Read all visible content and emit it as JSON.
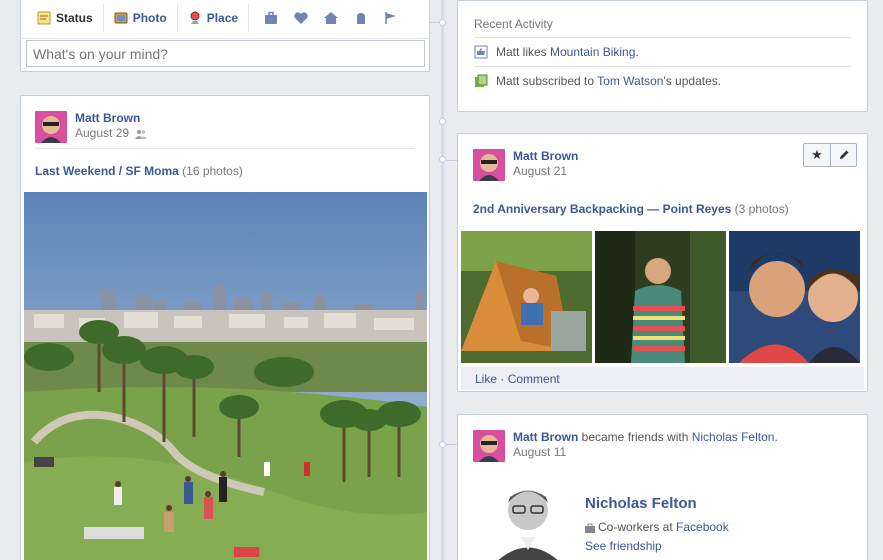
{
  "composer": {
    "tabs": [
      {
        "label": "Status",
        "icon": "status-icon"
      },
      {
        "label": "Photo",
        "icon": "photo-icon"
      },
      {
        "label": "Place",
        "icon": "place-icon"
      }
    ],
    "life_event_icons": [
      "briefcase-icon",
      "heart-icon",
      "home-icon",
      "health-icon",
      "flag-icon"
    ],
    "placeholder": "What's on your mind?"
  },
  "recent_activity": {
    "title": "Recent Activity",
    "rows": [
      {
        "icon": "like-page-icon",
        "pre": "Matt likes ",
        "link": "Mountain Biking",
        "post": "."
      },
      {
        "icon": "subscribe-icon",
        "pre": "Matt subscribed to ",
        "link": "Tom Watson",
        "post": "'s updates."
      }
    ]
  },
  "post_left": {
    "author": "Matt Brown",
    "date": "August 29",
    "album_link": "Last Weekend / SF Moma",
    "album_count": " (16 photos)"
  },
  "post_right_1": {
    "author": "Matt Brown",
    "date": "August 21",
    "album_link": "2nd Anniversary Backpacking — Point Reyes",
    "album_count": " (3 photos)",
    "like": "Like",
    "sep": " · ",
    "comment": "Comment"
  },
  "post_right_2": {
    "author": "Matt Brown",
    "action": " became friends with ",
    "friend_link": "Nicholas Felton",
    "end": ".",
    "date": "August 11",
    "friend_name": "Nicholas Felton",
    "coworkers_pre": "Co-workers at ",
    "coworkers_link": "Facebook",
    "see_friendship": "See friendship"
  },
  "colors": {
    "link": "#3b5998",
    "background": "#e9ebee",
    "border": "#c4cde0"
  }
}
